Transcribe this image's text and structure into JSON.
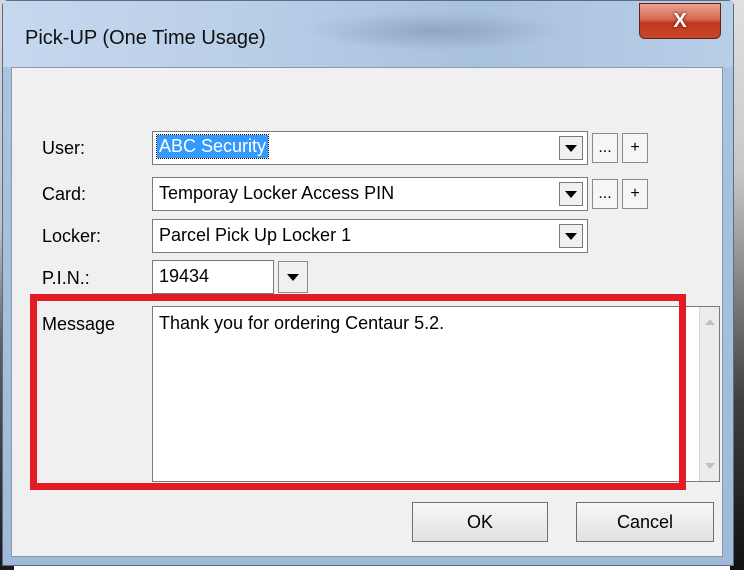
{
  "window": {
    "title": "Pick-UP (One Time Usage)",
    "close_glyph": "X"
  },
  "form": {
    "user": {
      "label": "User:",
      "value": "ABC  Security",
      "browse": "...",
      "add": "+"
    },
    "card": {
      "label": "Card:",
      "value": "Temporay Locker Access PIN",
      "browse": "...",
      "add": "+"
    },
    "locker": {
      "label": "Locker:",
      "value": "Parcel Pick Up Locker 1"
    },
    "pin": {
      "label": "P.I.N.:",
      "value": "19434"
    },
    "message": {
      "label": "Message",
      "value": "Thank you for ordering Centaur 5.2."
    }
  },
  "buttons": {
    "ok": "OK",
    "cancel": "Cancel"
  },
  "colors": {
    "highlight": "#e21b24",
    "selection": "#3399ff"
  }
}
